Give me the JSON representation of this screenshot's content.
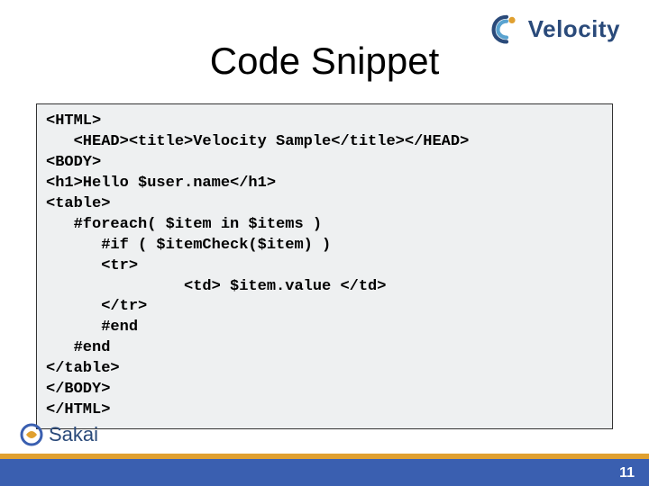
{
  "header": {
    "logo_wordmark": "Velocity"
  },
  "title": "Code Snippet",
  "code": "<HTML>\n   <HEAD><title>Velocity Sample</title></HEAD>\n<BODY>\n<h1>Hello $user.name</h1>\n<table>\n   #foreach( $item in $items )\n      #if ( $itemCheck($item) )\n      <tr>\n               <td> $item.value </td>\n      </tr>\n      #end\n   #end\n</table>\n</BODY>\n</HTML>",
  "footer": {
    "sakai_label": "Sakai",
    "page_number": "11"
  }
}
